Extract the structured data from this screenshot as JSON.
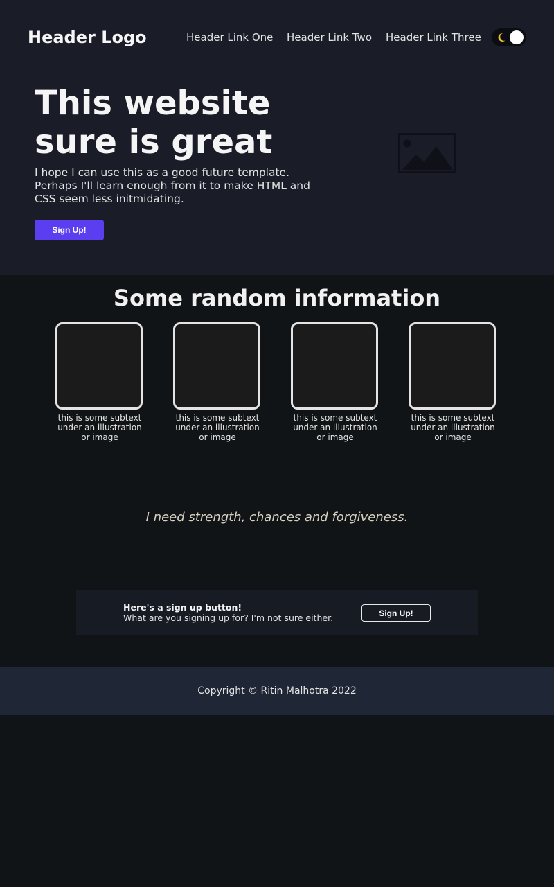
{
  "header": {
    "logo": "Header Logo",
    "links": [
      "Header Link One",
      "Header Link Two",
      "Header Link Three"
    ],
    "theme_toggle": {
      "icon": "moon-icon",
      "state": "dark"
    }
  },
  "hero": {
    "title": "This website sure is great",
    "text": "I hope I can use this as a good future template. Perhaps I'll learn enough from it to make HTML and CSS seem less initmidating.",
    "button": "Sign Up!",
    "image_icon": "image-placeholder-icon"
  },
  "info": {
    "title": "Some random information",
    "cards": [
      {
        "caption": "this is some subtext under an illustration or image"
      },
      {
        "caption": "this is some subtext under an illustration or image"
      },
      {
        "caption": "this is some subtext under an illustration or image"
      },
      {
        "caption": "this is some subtext under an illustration or image"
      }
    ]
  },
  "quote": "I need strength, chances and forgiveness.",
  "cta": {
    "title": "Here's a sign up button!",
    "subtitle": "What are you signing up for? I'm not sure either.",
    "button": "Sign Up!"
  },
  "footer": {
    "copyright": "Copyright © Ritin Malhotra 2022"
  },
  "colors": {
    "accent": "#5a3ef0",
    "moon": "#f2c22e",
    "hero_bg": "#1a1c28",
    "page_bg": "#111416",
    "footer_bg": "#1f2736"
  }
}
